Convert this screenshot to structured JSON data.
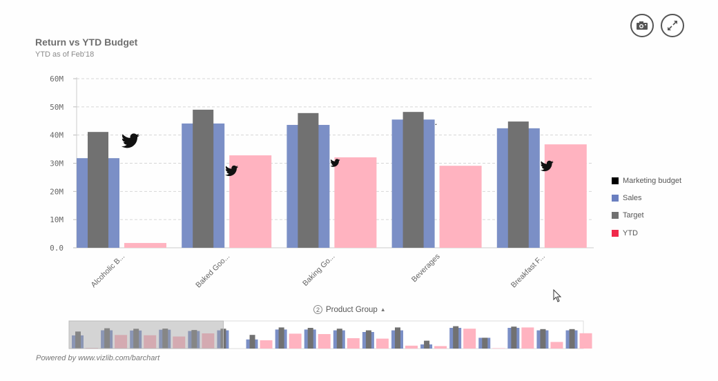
{
  "header": {
    "title": "Return vs YTD Budget",
    "subtitle": "YTD as of Feb'18"
  },
  "toolbar": {
    "snapshot_icon": "camera-icon",
    "expand_icon": "expand-icon"
  },
  "dimension": {
    "count": "2",
    "label": "Product Group",
    "sort_icon": "triangle-up-icon"
  },
  "footer": {
    "text": "Powered by www.vizlib.com/barchart"
  },
  "colors": {
    "Marketing budget": "#000000",
    "Sales": "#7b8fc6",
    "Target": "#717171",
    "YTD": "#ffb3c0",
    "YTD_legend": "#f0284a",
    "Sales_legend": "#6a7fc0",
    "axis_text": "#666666",
    "grid": "#d6d6d6"
  },
  "chart_data": {
    "type": "bar",
    "title": "Return vs YTD Budget",
    "subtitle": "YTD as of Feb'18",
    "xlabel": "Product Group",
    "ylabel": "",
    "ylim": [
      0,
      60000000
    ],
    "yticks": [
      "0.0",
      "10M",
      "20M",
      "30M",
      "40M",
      "50M",
      "60M"
    ],
    "grid": true,
    "legend_position": "right",
    "categories": [
      "Alcoholic B...",
      "Baked Goo...",
      "Baking Go...",
      "Beverages",
      "Breakfast F..."
    ],
    "series": [
      {
        "name": "Marketing budget",
        "type": "marker",
        "values": [
          38.5,
          27.7,
          30.4,
          43.8,
          29.4
        ]
      },
      {
        "name": "Sales",
        "type": "bar",
        "values": [
          31.8,
          44.1,
          43.6,
          45.5,
          42.4
        ]
      },
      {
        "name": "Target",
        "type": "bar",
        "values": [
          41.1,
          49.0,
          47.8,
          48.2,
          44.8
        ]
      },
      {
        "name": "YTD",
        "type": "bar",
        "values": [
          1.7,
          32.8,
          32.1,
          29.1,
          36.7
        ]
      }
    ],
    "units": "millions",
    "legend": [
      "Marketing budget",
      "Sales",
      "Target",
      "YTD"
    ],
    "navigator": {
      "visible_window_fraction": 0.3,
      "overview_groups": [
        {
          "sales": 31.8,
          "target": 41.1,
          "ytd": 1.7
        },
        {
          "sales": 44.1,
          "target": 49.0,
          "ytd": 32.8
        },
        {
          "sales": 43.6,
          "target": 47.8,
          "ytd": 32.1
        },
        {
          "sales": 45.5,
          "target": 48.2,
          "ytd": 29.1
        },
        {
          "sales": 42.4,
          "target": 44.8,
          "ytd": 36.7
        },
        {
          "sales": 44.0,
          "target": 48.0,
          "ytd": 0
        },
        {
          "sales": 22.0,
          "target": 33.0,
          "ytd": 20.0
        },
        {
          "sales": 46.0,
          "target": 51.0,
          "ytd": 36.0
        },
        {
          "sales": 46.0,
          "target": 50.0,
          "ytd": 35.0
        },
        {
          "sales": 44.0,
          "target": 48.0,
          "ytd": 25.0
        },
        {
          "sales": 40.0,
          "target": 44.0,
          "ytd": 24.0
        },
        {
          "sales": 44.0,
          "target": 51.0,
          "ytd": 7.0
        },
        {
          "sales": 10.0,
          "target": 19.0,
          "ytd": 6.0
        },
        {
          "sales": 50.0,
          "target": 54.0,
          "ytd": 48.0
        },
        {
          "sales": 26.0,
          "target": 26.0,
          "ytd": 1.0
        },
        {
          "sales": 50.0,
          "target": 53.0,
          "ytd": 51.0
        },
        {
          "sales": 44.0,
          "target": 47.0,
          "ytd": 16.0
        },
        {
          "sales": 44.0,
          "target": 47.0,
          "ytd": 37.0
        }
      ]
    }
  }
}
